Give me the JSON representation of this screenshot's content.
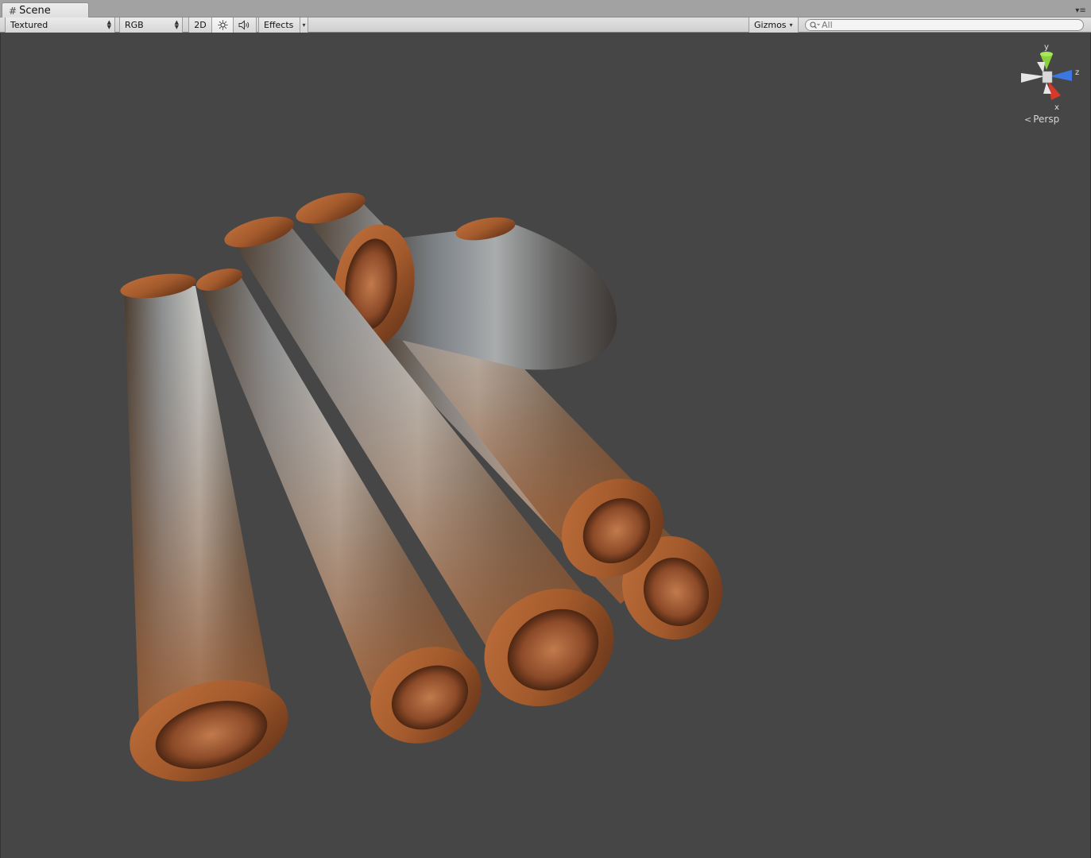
{
  "window": {
    "tab_label": "Scene"
  },
  "toolbar": {
    "shading_mode": "Textured",
    "render_mode": "RGB",
    "mode_2d_label": "2D",
    "lighting_icon": "sun-icon",
    "audio_icon": "speaker-icon",
    "effects_label": "Effects",
    "gizmos_label": "Gizmos",
    "search_placeholder": "All"
  },
  "scene_gizmo": {
    "axis_y": "y",
    "axis_z": "z",
    "axis_x": "x",
    "projection_label": "Persp",
    "colors": {
      "y": "#8ad13b",
      "z": "#3a77e0",
      "x": "#d6392b",
      "neutral": "#e6e6e6"
    }
  },
  "viewport": {
    "background": "#464646",
    "content": "rusted pipes"
  }
}
